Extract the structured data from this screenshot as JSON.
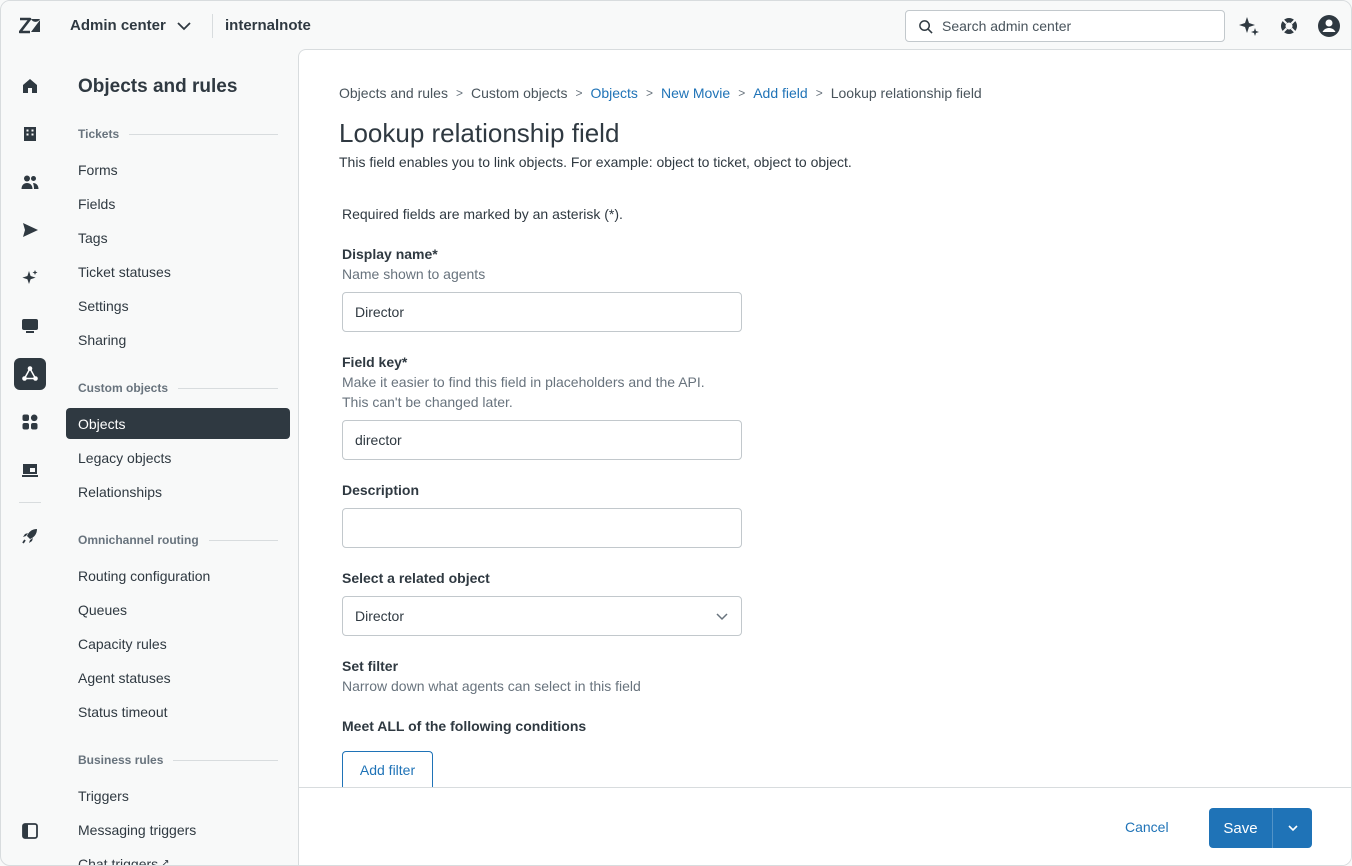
{
  "header": {
    "product_name": "Admin center",
    "brand_name": "internalnote",
    "search_placeholder": "Search admin center"
  },
  "rail": {
    "icons": [
      "home-icon",
      "building-icon",
      "people-icon",
      "send-icon",
      "sparkle-icon",
      "chat-icon",
      "objects-icon",
      "apps-icon",
      "workspace-icon",
      "rocket-icon",
      "sidebar-toggle-icon"
    ]
  },
  "subnav": {
    "title": "Objects and rules",
    "sections": {
      "tickets": {
        "heading": "Tickets",
        "items": [
          "Forms",
          "Fields",
          "Tags",
          "Ticket statuses",
          "Settings",
          "Sharing"
        ]
      },
      "custom_objects": {
        "heading": "Custom objects",
        "items": [
          "Objects",
          "Legacy objects",
          "Relationships"
        ]
      },
      "omnichannel": {
        "heading": "Omnichannel routing",
        "items": [
          "Routing configuration",
          "Queues",
          "Capacity rules",
          "Agent statuses",
          "Status timeout"
        ]
      },
      "business_rules": {
        "heading": "Business rules",
        "items": [
          "Triggers",
          "Messaging triggers",
          "Chat triggers"
        ]
      }
    }
  },
  "breadcrumb": [
    "Objects and rules",
    "Custom objects",
    "Objects",
    "New Movie",
    "Add field",
    "Lookup relationship field"
  ],
  "page": {
    "title": "Lookup relationship field",
    "description": "This field enables you to link objects. For example: object to ticket, object to object.",
    "required_note": "Required fields are marked by an asterisk (*)."
  },
  "form": {
    "display_name": {
      "label": "Display name*",
      "hint": "Name shown to agents",
      "value": "Director"
    },
    "field_key": {
      "label": "Field key*",
      "hint_line1": "Make it easier to find this field in placeholders and the API.",
      "hint_line2": "This can't be changed later.",
      "value": "director"
    },
    "description": {
      "label": "Description",
      "value": ""
    },
    "related_object": {
      "label": "Select a related object",
      "value": "Director"
    },
    "filter": {
      "label": "Set filter",
      "hint": "Narrow down what agents can select in this field",
      "conditions_label": "Meet ALL of the following conditions",
      "add_label": "Add filter"
    }
  },
  "footer": {
    "cancel_label": "Cancel",
    "save_label": "Save"
  },
  "colors": {
    "accent": "#1f73b7",
    "nav_active": "#2f3941",
    "text": "#2f3941",
    "muted": "#68737d"
  }
}
